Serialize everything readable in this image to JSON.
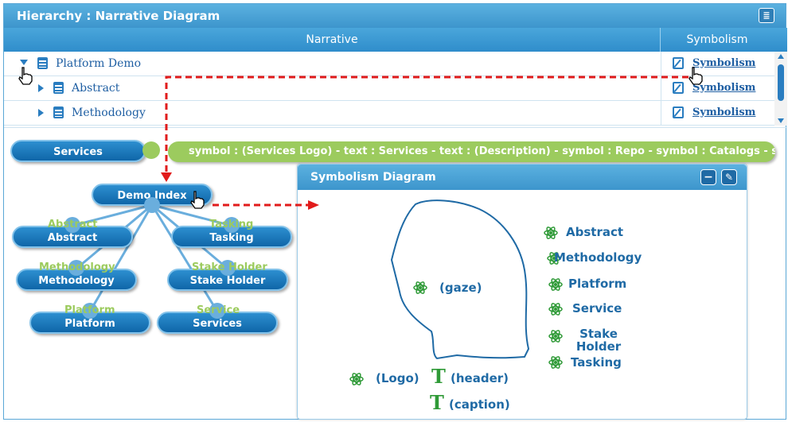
{
  "window": {
    "title": "Hierarchy : Narrative Diagram",
    "icon": "list-icon"
  },
  "grid": {
    "columns": [
      "Narrative",
      "Symbolism"
    ],
    "rows": [
      {
        "label": "Platform Demo",
        "expanded": true,
        "link": "Symbolism"
      },
      {
        "label": "Abstract",
        "expanded": false,
        "link": "Symbolism"
      },
      {
        "label": "Methodology",
        "expanded": false,
        "link": "Symbolism"
      }
    ]
  },
  "diagram": {
    "top_node": "Services",
    "symbol_text": "symbol : (Services Logo) - text : Services - text : (Description) - symbol : Repo - symbol : Catalogs - sy",
    "hub_node": "Demo Index",
    "children": [
      {
        "label": "Abstract",
        "ghost": "Abstract"
      },
      {
        "label": "Tasking",
        "ghost": "Tasking"
      },
      {
        "label": "Methodology",
        "ghost": "Methodology"
      },
      {
        "label": "Stake Holder",
        "ghost": "Stake Holder"
      },
      {
        "label": "Platform",
        "ghost": "Platform"
      },
      {
        "label": "Services",
        "ghost": "Service"
      }
    ]
  },
  "symbolism_panel": {
    "title": "Symbolism Diagram",
    "head_label": "(gaze)",
    "right_items": [
      "Abstract",
      "Methodology",
      "Platform",
      "Service",
      "Stake Holder",
      "Tasking"
    ],
    "bottom": {
      "logo": "(Logo)",
      "header": "(header)",
      "caption": "(caption)",
      "t_glyph": "T"
    }
  },
  "colors": {
    "accent": "#3d95cc",
    "green": "#9ccb5e",
    "arrow": "#e11b1b",
    "link": "#1f5fa3"
  }
}
